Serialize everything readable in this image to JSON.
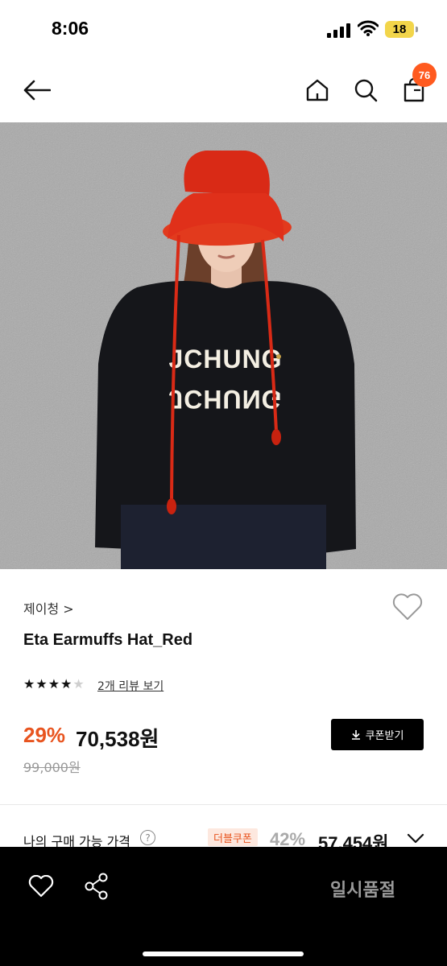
{
  "status": {
    "time": "8:06",
    "battery": "18"
  },
  "nav": {
    "cart_count": "76"
  },
  "hero": {
    "sweater_text": "JCHUNG"
  },
  "product": {
    "brand": "제이청 >",
    "name": "Eta Earmuffs Hat_Red",
    "rating": 4,
    "rating_max": 5,
    "review_link": "2개 리뷰 보기",
    "discount": "29%",
    "price": "70,538원",
    "original_price": "99,000원",
    "coupon_button": "쿠폰받기"
  },
  "my_price": {
    "label": "나의 구매 가능 가격",
    "help": "?",
    "badge": "더블쿠폰",
    "discount": "42%",
    "price": "57,454원"
  },
  "bottom": {
    "status_label": "일시품절"
  },
  "colors": {
    "accent": "#e8541f",
    "badge": "#ff5a1f",
    "hat": "#e0301a"
  }
}
